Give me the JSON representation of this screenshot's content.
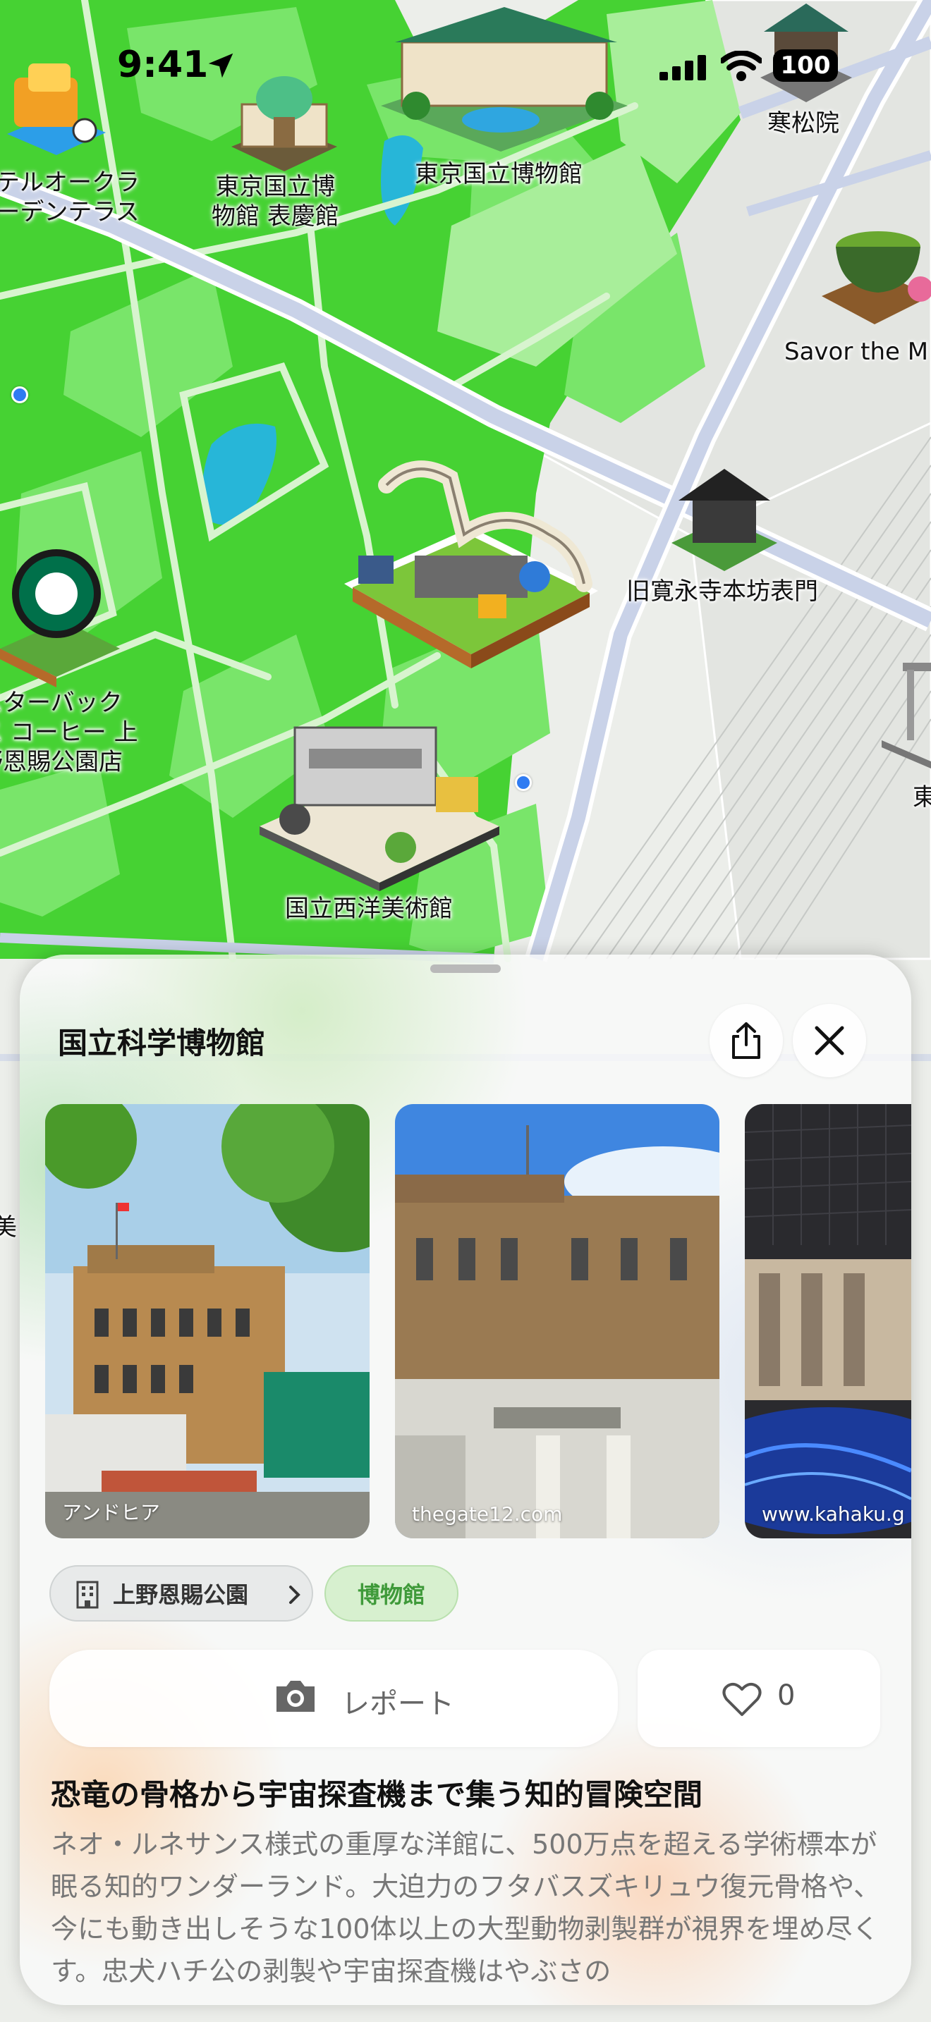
{
  "status_bar": {
    "time": "9:41",
    "battery": "100"
  },
  "map": {
    "labels": {
      "okura": "ホテルオークラ\nガーデンテラス",
      "hyokeikan": "東京国立博\n物館 表慶館",
      "tnm": "東京国立博物館",
      "kanshoin": "寒松院",
      "savor": "Savor the M",
      "kaneiji": "旧寛永寺本坊表門",
      "starbucks": "スターバック\nス コーヒー 上\n野恩賜公園店",
      "western_art": "国立西洋美術館",
      "right_edge": "東",
      "left_edge": "美"
    }
  },
  "sheet": {
    "title": "国立科学博物館",
    "photos": [
      {
        "credit": "アンドヒア"
      },
      {
        "credit": "thegate12.com"
      },
      {
        "credit": "www.kahaku.g"
      }
    ],
    "park_chip": "上野恩賜公園",
    "category_chip": "博物館",
    "report_label": "レポート",
    "like_count": "0",
    "headline": "恐竜の骨格から宇宙探査機まで集う知的冒険空間",
    "description": "ネオ・ルネサンス様式の重厚な洋館に、500万点を超える学術標本が眠る知的ワンダーランド。大迫力のフタバスズキリュウ復元骨格や、今にも動き出しそうな100体以上の大型動物剥製群が視界を埋め尽くす。忠犬ハチ公の剥製や宇宙探査機はやぶさの"
  },
  "colors": {
    "park_green": "#46d233",
    "accent_green": "#3f9a3a",
    "road": "#c9d2e8"
  }
}
